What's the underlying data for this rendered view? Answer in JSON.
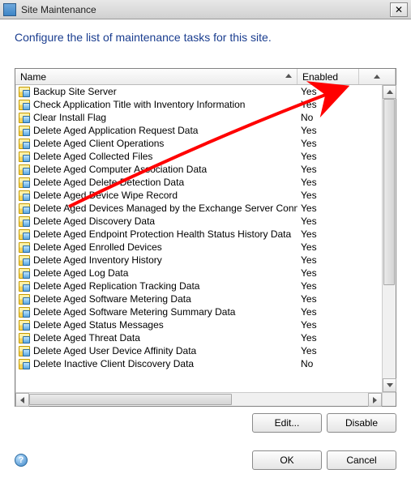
{
  "window": {
    "title": "Site Maintenance"
  },
  "heading": "Configure the list of maintenance tasks for this site.",
  "columns": {
    "name": "Name",
    "enabled": "Enabled"
  },
  "tasks": [
    {
      "label": "Backup Site Server",
      "enabled": "Yes"
    },
    {
      "label": "Check Application Title with Inventory Information",
      "enabled": "Yes"
    },
    {
      "label": "Clear Install Flag",
      "enabled": "No"
    },
    {
      "label": "Delete Aged Application Request Data",
      "enabled": "Yes"
    },
    {
      "label": "Delete Aged Client Operations",
      "enabled": "Yes"
    },
    {
      "label": "Delete Aged Collected Files",
      "enabled": "Yes"
    },
    {
      "label": "Delete Aged Computer Association Data",
      "enabled": "Yes"
    },
    {
      "label": "Delete Aged Delete Detection Data",
      "enabled": "Yes"
    },
    {
      "label": "Delete Aged Device Wipe Record",
      "enabled": "Yes"
    },
    {
      "label": "Delete Aged Devices Managed by the Exchange Server Connector",
      "enabled": "Yes"
    },
    {
      "label": "Delete Aged Discovery Data",
      "enabled": "Yes"
    },
    {
      "label": "Delete Aged Endpoint Protection Health Status History Data",
      "enabled": "Yes"
    },
    {
      "label": "Delete Aged Enrolled Devices",
      "enabled": "Yes"
    },
    {
      "label": "Delete Aged Inventory History",
      "enabled": "Yes"
    },
    {
      "label": "Delete Aged Log Data",
      "enabled": "Yes"
    },
    {
      "label": "Delete Aged Replication Tracking Data",
      "enabled": "Yes"
    },
    {
      "label": "Delete Aged Software Metering Data",
      "enabled": "Yes"
    },
    {
      "label": "Delete Aged Software Metering Summary Data",
      "enabled": "Yes"
    },
    {
      "label": "Delete Aged Status Messages",
      "enabled": "Yes"
    },
    {
      "label": "Delete Aged Threat Data",
      "enabled": "Yes"
    },
    {
      "label": "Delete Aged User Device Affinity Data",
      "enabled": "Yes"
    },
    {
      "label": "Delete Inactive Client Discovery Data",
      "enabled": "No"
    }
  ],
  "buttons": {
    "edit": "Edit...",
    "disable": "Disable",
    "ok": "OK",
    "cancel": "Cancel"
  },
  "annotation": {
    "color": "#ff0000"
  }
}
